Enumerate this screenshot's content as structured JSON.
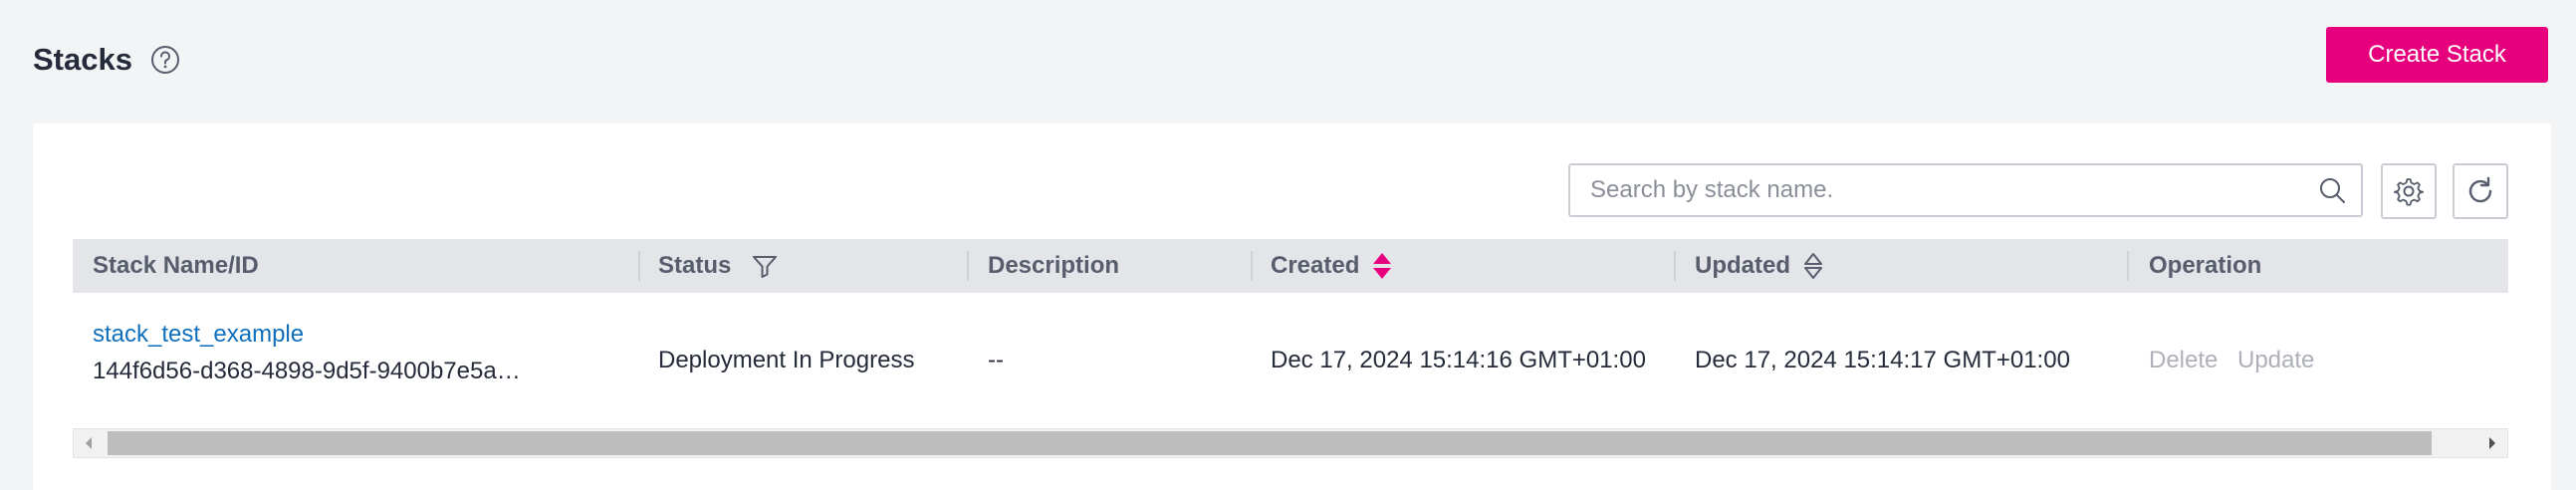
{
  "header": {
    "title": "Stacks",
    "help_icon": "question-circle-icon"
  },
  "create_button": {
    "label": "Create Stack",
    "color": "#e6007e"
  },
  "toolbar": {
    "search_placeholder": "Search by stack name.",
    "search_value": "",
    "settings_icon": "gear-icon",
    "refresh_icon": "refresh-icon"
  },
  "table": {
    "columns": {
      "name": "Stack Name/ID",
      "status": "Status",
      "description": "Description",
      "created": "Created",
      "updated": "Updated",
      "operation": "Operation"
    },
    "rows": [
      {
        "name": "stack_test_example",
        "id": "144f6d56-d368-4898-9d5f-9400b7e5a…",
        "status": "Deployment In Progress",
        "description": "--",
        "created": "Dec 17, 2024 15:14:16 GMT+01:00",
        "updated": "Dec 17, 2024 15:14:17 GMT+01:00",
        "delete_label": "Delete",
        "update_label": "Update"
      }
    ]
  },
  "colors": {
    "accent": "#e6007e",
    "link": "#0f6fbd",
    "disabled_text": "#adb0b8"
  }
}
